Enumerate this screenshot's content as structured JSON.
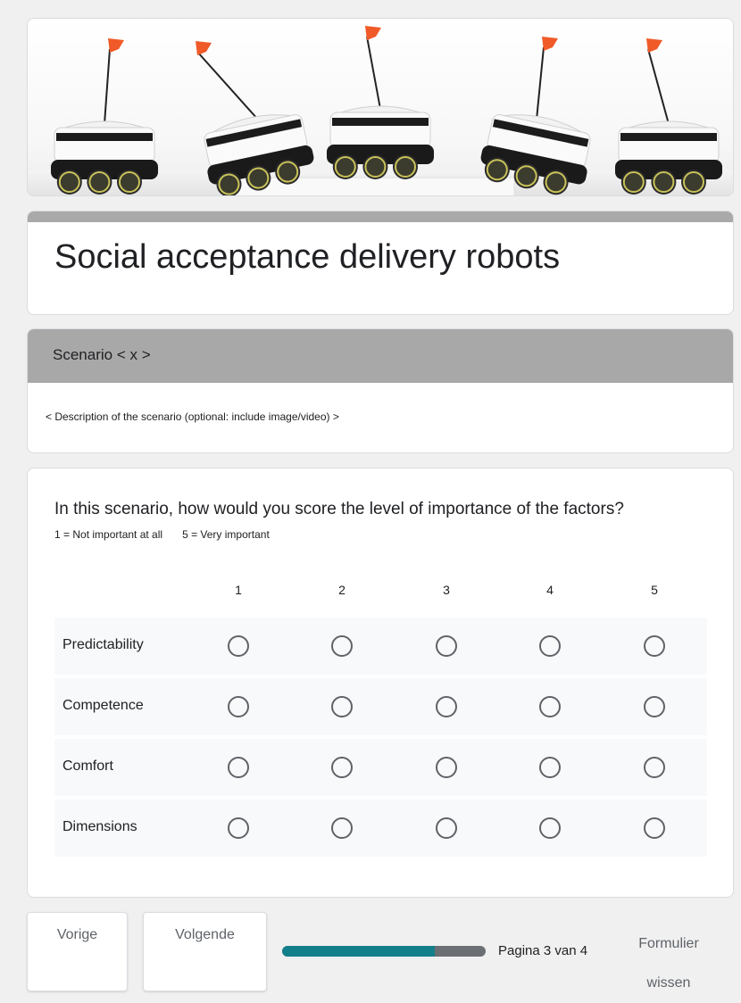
{
  "form": {
    "title": "Social acceptance delivery robots"
  },
  "section": {
    "title": "Scenario < x >",
    "description": "< Description of the scenario (optional: include image/video) >"
  },
  "question": {
    "text": "In this scenario, how would you score the level of importance of the factors?",
    "scale_low": "1 = Not important at all",
    "scale_high": "5 = Very important",
    "columns": [
      "1",
      "2",
      "3",
      "4",
      "5"
    ],
    "rows": [
      "Predictability",
      "Competence",
      "Comfort",
      "Dimensions"
    ]
  },
  "footer": {
    "prev_label": "Vorige",
    "next_label": "Volgende",
    "page_indicator": "Pagina 3 van 4",
    "clear_label": "Formulier wissen",
    "progress_fraction": 0.75
  },
  "colors": {
    "progress_fill": "#137f8a",
    "progress_track": "#6b6e72",
    "header_gray": "#a8a8a8",
    "robot_flag": "#f05a28"
  }
}
